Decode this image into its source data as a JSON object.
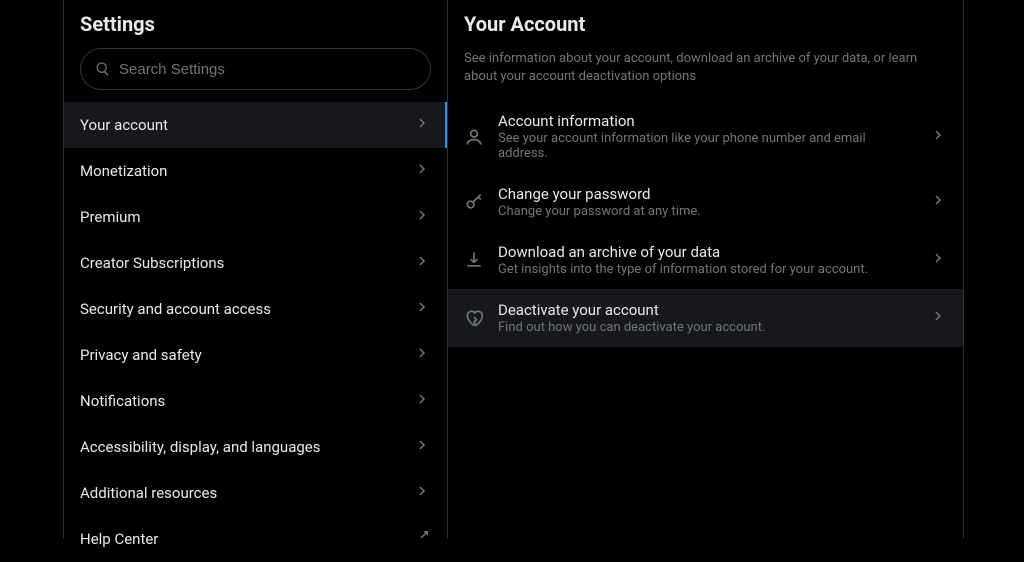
{
  "settings": {
    "title": "Settings",
    "search_placeholder": "Search Settings",
    "nav": [
      {
        "label": "Your account",
        "icon": "chevron",
        "active": true
      },
      {
        "label": "Monetization",
        "icon": "chevron",
        "active": false
      },
      {
        "label": "Premium",
        "icon": "chevron",
        "active": false
      },
      {
        "label": "Creator Subscriptions",
        "icon": "chevron",
        "active": false
      },
      {
        "label": "Security and account access",
        "icon": "chevron",
        "active": false
      },
      {
        "label": "Privacy and safety",
        "icon": "chevron",
        "active": false
      },
      {
        "label": "Notifications",
        "icon": "chevron",
        "active": false
      },
      {
        "label": "Accessibility, display, and languages",
        "icon": "chevron",
        "active": false
      },
      {
        "label": "Additional resources",
        "icon": "chevron",
        "active": false
      },
      {
        "label": "Help Center",
        "icon": "external",
        "active": false
      }
    ]
  },
  "detail": {
    "title": "Your Account",
    "description": "See information about your account, download an archive of your data, or learn about your account deactivation options",
    "options": [
      {
        "icon": "user",
        "title": "Account information",
        "subtitle": "See your account information like your phone number and email address.",
        "hover": false
      },
      {
        "icon": "key",
        "title": "Change your password",
        "subtitle": "Change your password at any time.",
        "hover": false
      },
      {
        "icon": "download",
        "title": "Download an archive of your data",
        "subtitle": "Get insights into the type of information stored for your account.",
        "hover": false
      },
      {
        "icon": "heart-broken",
        "title": "Deactivate your account",
        "subtitle": "Find out how you can deactivate your account.",
        "hover": true
      }
    ]
  }
}
